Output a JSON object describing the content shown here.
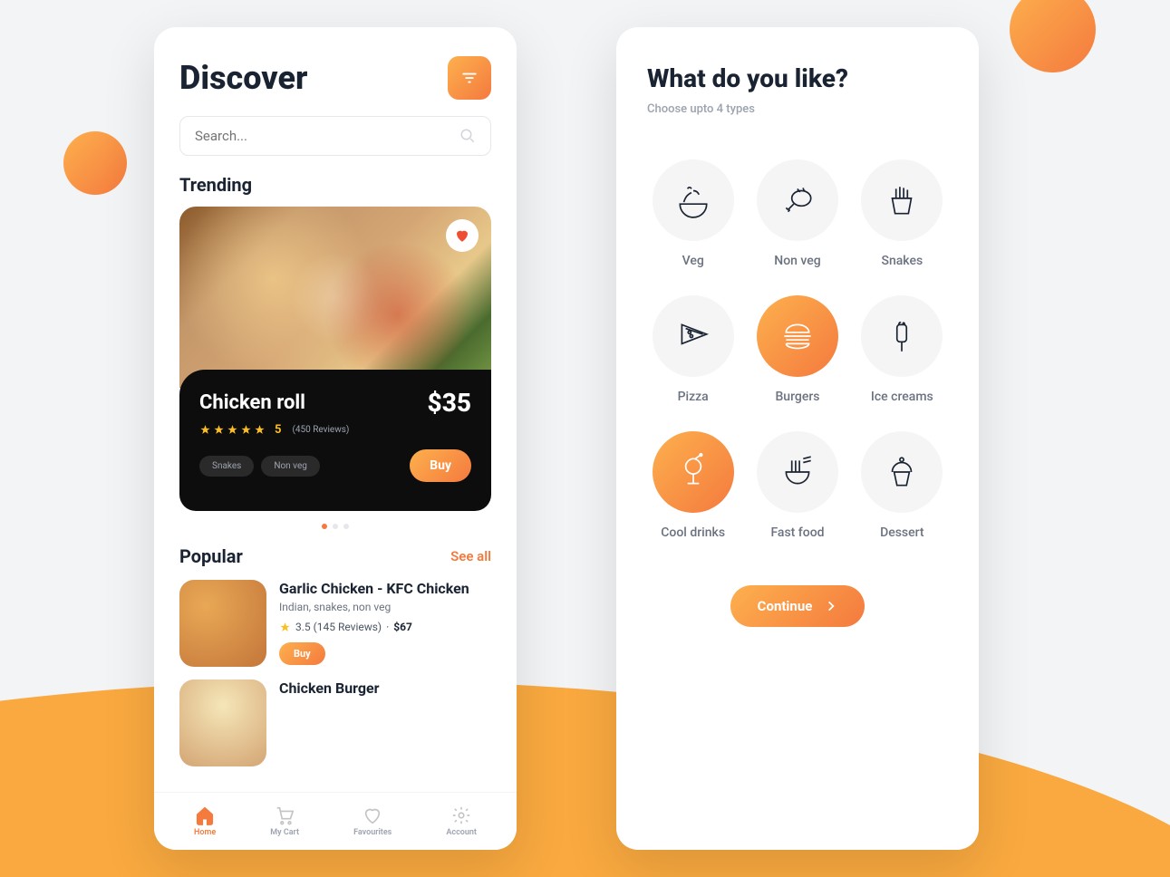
{
  "colors": {
    "accent_gradient_start": "#fdb04e",
    "accent_gradient_end": "#f47a3e"
  },
  "discover": {
    "title": "Discover",
    "search_placeholder": "Search...",
    "trending_title": "Trending",
    "card": {
      "name": "Chicken roll",
      "price": "$35",
      "rating": "5",
      "reviews": "(450 Reviews)",
      "tags": [
        "Snakes",
        "Non veg"
      ],
      "buy_label": "Buy"
    },
    "popular": {
      "title": "Popular",
      "see_all": "See all",
      "items": [
        {
          "name": "Garlic Chicken - KFC Chicken",
          "categories": "Indian, snakes, non veg",
          "rating": "3.5 (145 Reviews)",
          "price": "$67",
          "buy_label": "Buy"
        },
        {
          "name": "Chicken Burger",
          "categories": "",
          "rating": "",
          "price": "",
          "buy_label": ""
        }
      ]
    },
    "tabs": [
      {
        "label": "Home"
      },
      {
        "label": "My Cart"
      },
      {
        "label": "Favourites"
      },
      {
        "label": "Account"
      }
    ]
  },
  "prefs": {
    "title": "What do you like?",
    "subtitle": "Choose upto 4 types",
    "categories": [
      {
        "label": "Veg",
        "selected": false
      },
      {
        "label": "Non veg",
        "selected": false
      },
      {
        "label": "Snakes",
        "selected": false
      },
      {
        "label": "Pizza",
        "selected": false
      },
      {
        "label": "Burgers",
        "selected": true
      },
      {
        "label": "Ice creams",
        "selected": false
      },
      {
        "label": "Cool drinks",
        "selected": true
      },
      {
        "label": "Fast food",
        "selected": false
      },
      {
        "label": "Dessert",
        "selected": false
      }
    ],
    "continue_label": "Continue"
  }
}
